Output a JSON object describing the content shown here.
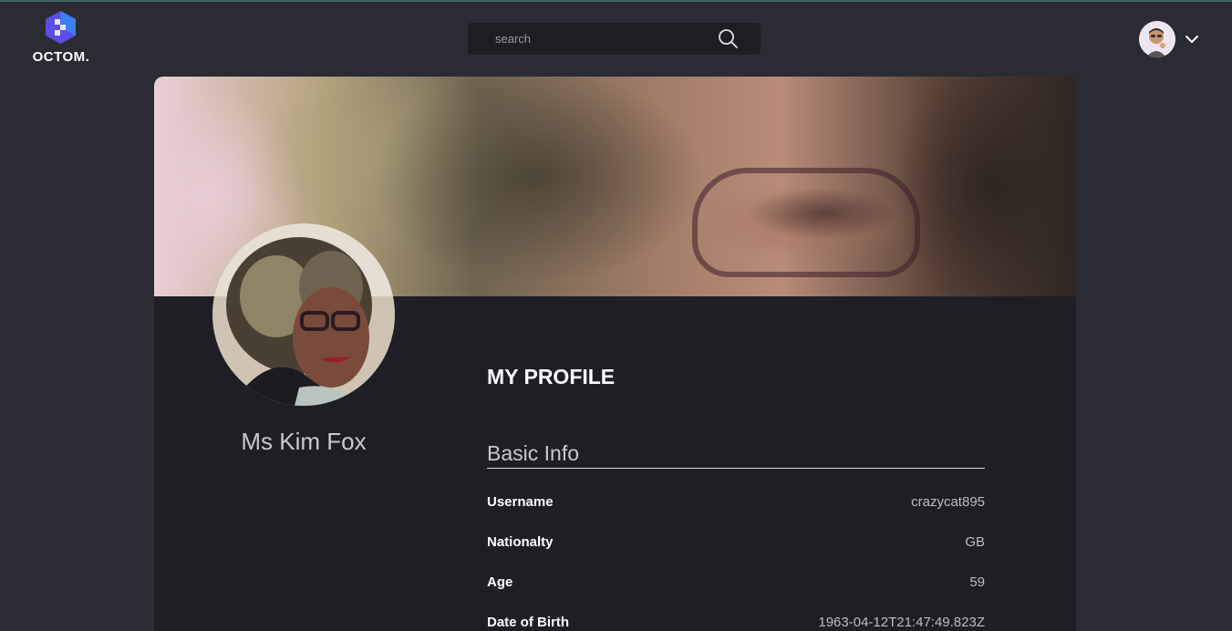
{
  "header": {
    "logo_text": "OCTOM.",
    "search_placeholder": "search"
  },
  "profile": {
    "name": "Ms Kim Fox",
    "section_title": "MY PROFILE",
    "subsection_title": "Basic Info",
    "fields": [
      {
        "label": "Username",
        "value": "crazycat895"
      },
      {
        "label": "Nationalty",
        "value": "GB"
      },
      {
        "label": "Age",
        "value": "59"
      },
      {
        "label": "Date of Birth",
        "value": "1963-04-12T21:47:49.823Z"
      }
    ]
  },
  "colors": {
    "background": "#2b2c33",
    "card": "#1e1f24",
    "logo_primary": "#4f5fe8",
    "logo_secondary": "#2f8ef0"
  }
}
